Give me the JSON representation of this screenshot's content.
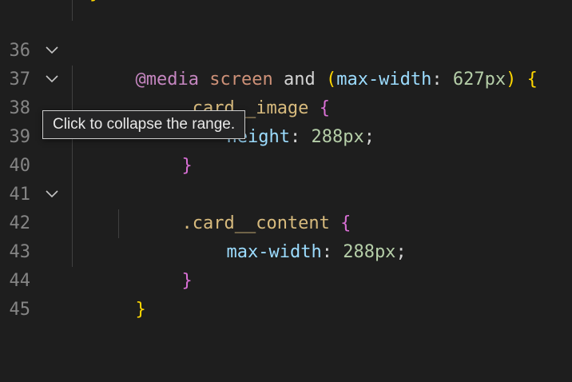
{
  "lines": [
    {
      "number": "36"
    },
    {
      "number": "37",
      "code": {
        "at": "@media",
        "screen": "screen",
        "and": "and",
        "open_paren": "(",
        "prop": "max-width",
        "colon": ":",
        "value": "627px",
        "close_paren": ")",
        "brace": "{"
      }
    },
    {
      "number": "38",
      "code": {
        "selector": ".card__image",
        "brace": "{"
      }
    },
    {
      "number": "39",
      "code": {
        "prop": "height",
        "colon": ":",
        "value": "288px",
        "semi": ";"
      }
    },
    {
      "number": "40",
      "code": {
        "brace": "}"
      }
    },
    {
      "number": "41"
    },
    {
      "number": "42",
      "code": {
        "selector": ".card__content",
        "brace": "{"
      }
    },
    {
      "number": "43",
      "code": {
        "prop": "max-width",
        "colon": ":",
        "value": "288px",
        "semi": ";"
      }
    },
    {
      "number": "44",
      "code": {
        "brace": "}"
      }
    },
    {
      "number": "45",
      "code": {
        "brace": "}"
      }
    }
  ],
  "tooltip": {
    "text": "Click to collapse the range."
  },
  "colors": {
    "background": "#1e1e1e",
    "line_number": "#858585",
    "at_rule": "#c586c0",
    "property": "#9cdcfe",
    "number": "#b5cea8",
    "selector": "#d7ba7d",
    "brace_gold": "#ffd700",
    "brace_pink": "#da70d6"
  },
  "icons": {
    "fold": "chevron-down-icon"
  }
}
